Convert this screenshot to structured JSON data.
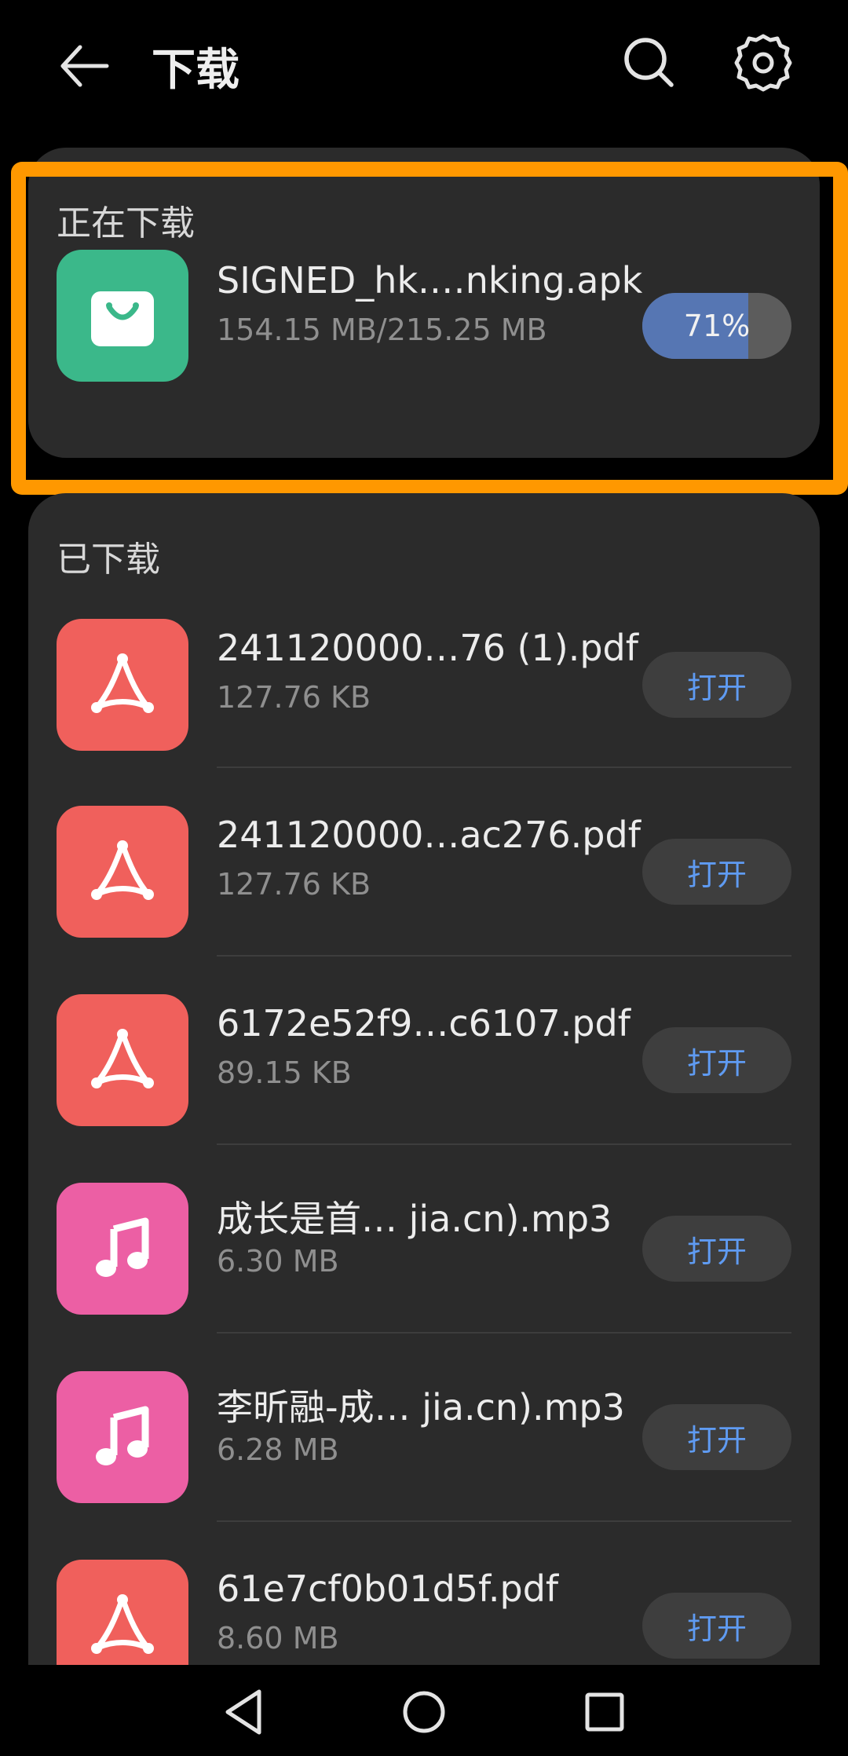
{
  "header": {
    "title": "下载",
    "back_icon": "arrow-left-icon",
    "search_icon": "search-icon",
    "settings_icon": "gear-icon"
  },
  "downloading": {
    "section_title": "正在下载",
    "item": {
      "icon": "shopping-bag-icon",
      "icon_color": "#3bb88a",
      "name": "SIGNED_hk.…nking.apk",
      "size": "154.15 MB/215.25 MB",
      "progress_percent": 71,
      "progress_label": "71%"
    }
  },
  "downloaded": {
    "section_title": "已下载",
    "items": [
      {
        "name": "241120000…76 (1).pdf",
        "size": "127.76 KB",
        "type": "pdf",
        "action": "打开"
      },
      {
        "name": "241120000…ac276.pdf",
        "size": "127.76 KB",
        "type": "pdf",
        "action": "打开"
      },
      {
        "name": "6172e52f9…c6107.pdf",
        "size": "89.15 KB",
        "type": "pdf",
        "action": "打开"
      },
      {
        "name": "成长是首… jia.cn).mp3",
        "size": "6.30 MB",
        "type": "mp3",
        "action": "打开"
      },
      {
        "name": "李昕融-成… jia.cn).mp3",
        "size": "6.28 MB",
        "type": "mp3",
        "action": "打开"
      },
      {
        "name": "61e7cf0b01d5f.pdf",
        "size": "8.60 MB",
        "type": "pdf",
        "action": "打开"
      }
    ]
  },
  "colors": {
    "pdf_icon": "#f0605c",
    "music_icon": "#ec5fa4",
    "accent_blue": "#5f9bf2",
    "highlight": "#ff9800"
  },
  "navbar": {
    "back_icon": "nav-back-triangle-icon",
    "home_icon": "nav-home-circle-icon",
    "recent_icon": "nav-recent-square-icon"
  }
}
